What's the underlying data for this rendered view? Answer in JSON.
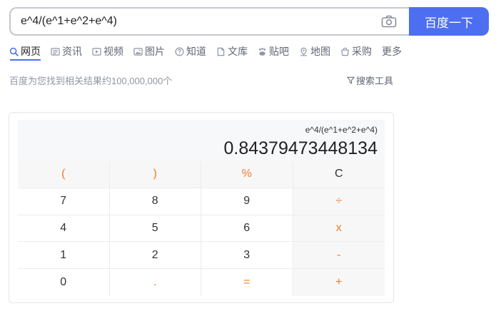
{
  "search": {
    "query": "e^4/(e^1+e^2+e^4)",
    "button_label": "百度一下"
  },
  "tabs": [
    {
      "label": "网页",
      "icon": "search-icon",
      "active": true
    },
    {
      "label": "资讯",
      "icon": "news-icon"
    },
    {
      "label": "视频",
      "icon": "video-icon"
    },
    {
      "label": "图片",
      "icon": "image-icon"
    },
    {
      "label": "知道",
      "icon": "question-icon"
    },
    {
      "label": "文库",
      "icon": "document-icon"
    },
    {
      "label": "贴吧",
      "icon": "tieba-icon"
    },
    {
      "label": "地图",
      "icon": "map-icon"
    },
    {
      "label": "采购",
      "icon": "cart-icon"
    },
    {
      "label": "更多"
    }
  ],
  "results": {
    "count_text": "百度为您找到相关结果约100,000,000个",
    "tools_label": "搜索工具"
  },
  "calculator": {
    "expression": "e^4/(e^1+e^2+e^4)",
    "result": "0.84379473448134",
    "keys": [
      [
        "(",
        ")",
        "%",
        "C"
      ],
      [
        "7",
        "8",
        "9",
        "÷"
      ],
      [
        "4",
        "5",
        "6",
        "x"
      ],
      [
        "1",
        "2",
        "3",
        "-"
      ],
      [
        "0",
        ".",
        "=",
        "+"
      ]
    ]
  },
  "colors": {
    "accent": "#4e6ef2",
    "operator": "#f37a2b"
  }
}
